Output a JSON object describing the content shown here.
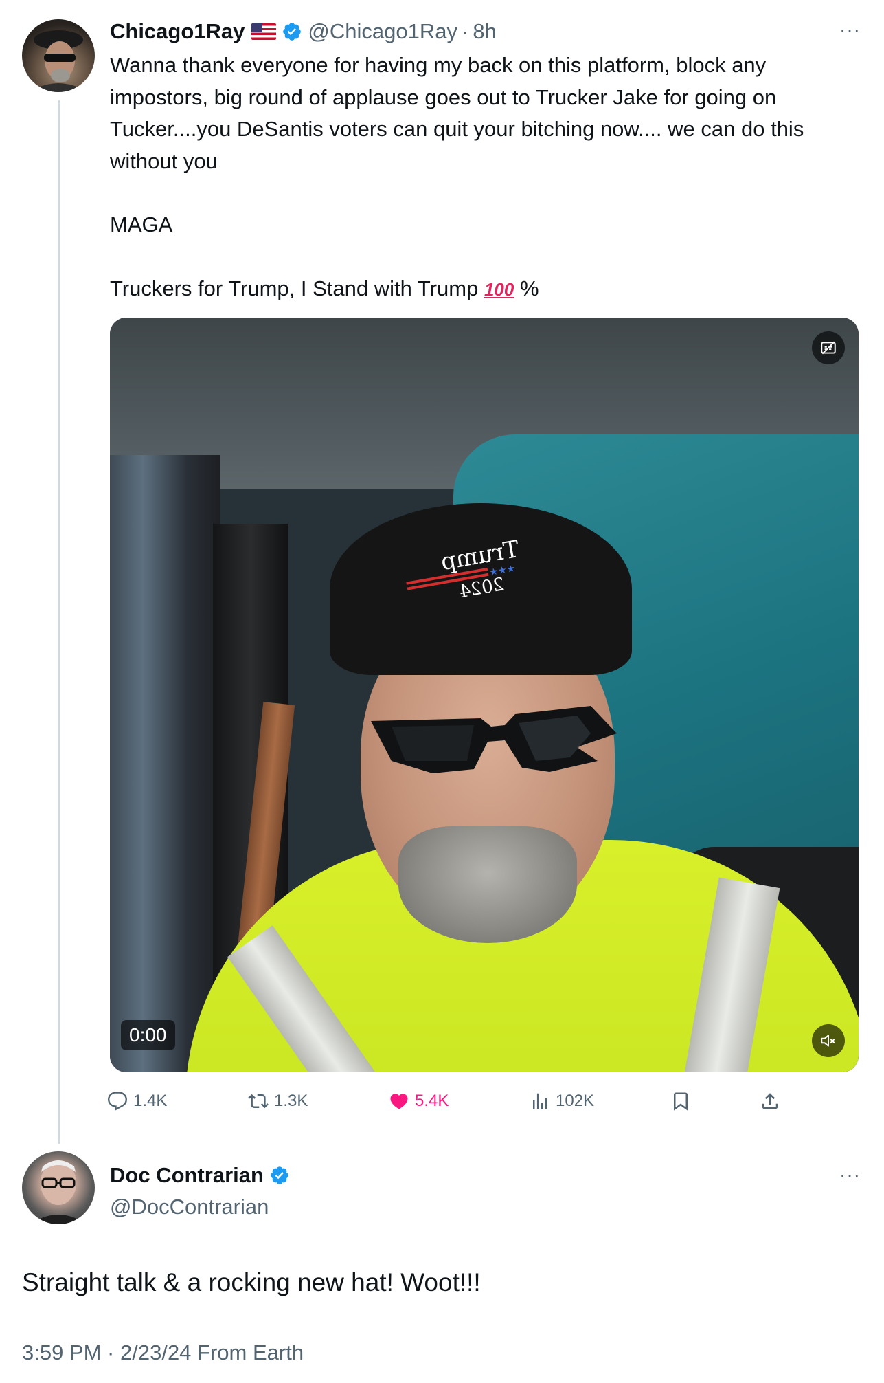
{
  "tweet": {
    "display_name": "Chicago1Ray",
    "handle": "@Chicago1Ray",
    "separator": "·",
    "time": "8h",
    "more": "···",
    "text_lines": [
      "Wanna thank everyone for having my back on this platform, block any impostors, big round of applause goes out to Trucker Jake for going on Tucker....you DeSantis voters can quit your bitching now.... we can do this without you",
      "MAGA",
      "Truckers for Trump, I Stand with Trump"
    ],
    "hundred_emoji": "100",
    "percent": "%",
    "video": {
      "timestamp": "0:00"
    },
    "metrics": {
      "replies": "1.4K",
      "retweets": "1.3K",
      "likes": "5.4K",
      "views": "102K"
    },
    "colors": {
      "like_active": "#f91880",
      "verified": "#1d9bf0",
      "secondary_text": "#536471"
    }
  },
  "reply": {
    "display_name": "Doc Contrarian",
    "handle": "@DocContrarian",
    "more": "···",
    "text": "Straight talk & a rocking new hat! Woot!!!",
    "meta": "3:59 PM · 2/23/24 From Earth"
  }
}
